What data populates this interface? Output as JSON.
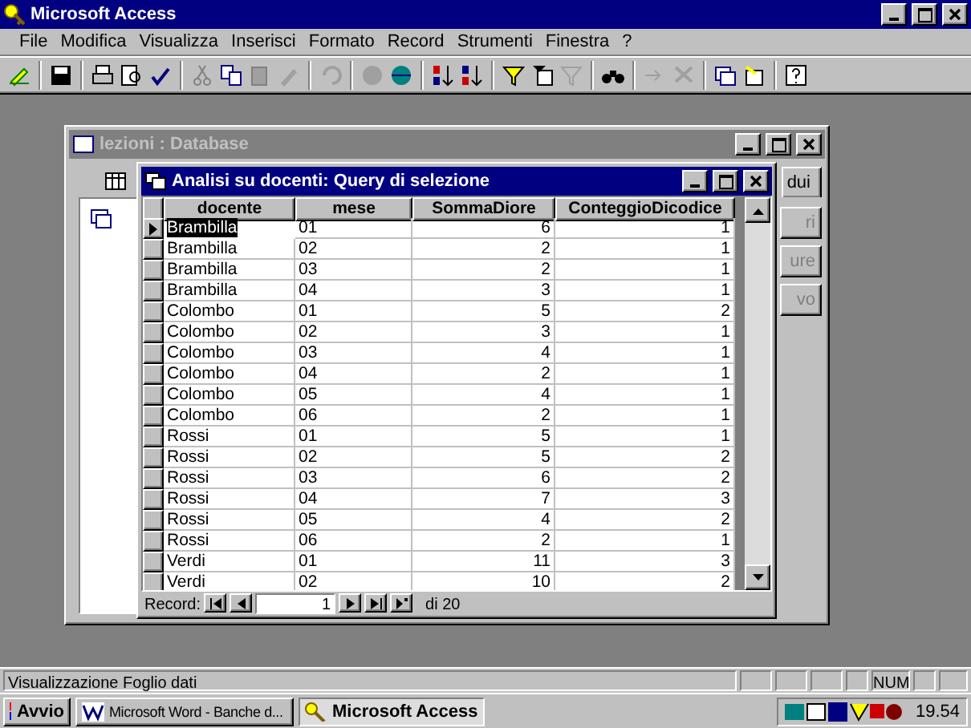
{
  "window": {
    "title": "Microsoft Access"
  },
  "menu": [
    "File",
    "Modifica",
    "Visualizza",
    "Inserisci",
    "Formato",
    "Record",
    "Strumenti",
    "Finestra",
    "?"
  ],
  "database_window": {
    "title": "lezioni : Database",
    "tab_fragment": "dui",
    "buttons": [
      "ri",
      "ure",
      "vo"
    ]
  },
  "query_window": {
    "title": "Analisi su docenti: Query di selezione",
    "columns": [
      "docente",
      "mese",
      "SommaDiore",
      "ConteggioDicodice"
    ],
    "rows": [
      {
        "cells": [
          "Brambilla",
          "01",
          "6",
          "1"
        ],
        "selected": true
      },
      {
        "cells": [
          "Brambilla",
          "02",
          "2",
          "1"
        ],
        "selected": false
      },
      {
        "cells": [
          "Brambilla",
          "03",
          "2",
          "1"
        ],
        "selected": false
      },
      {
        "cells": [
          "Brambilla",
          "04",
          "3",
          "1"
        ],
        "selected": false
      },
      {
        "cells": [
          "Colombo",
          "01",
          "5",
          "2"
        ],
        "selected": false
      },
      {
        "cells": [
          "Colombo",
          "02",
          "3",
          "1"
        ],
        "selected": false
      },
      {
        "cells": [
          "Colombo",
          "03",
          "4",
          "1"
        ],
        "selected": false
      },
      {
        "cells": [
          "Colombo",
          "04",
          "2",
          "1"
        ],
        "selected": false
      },
      {
        "cells": [
          "Colombo",
          "05",
          "4",
          "1"
        ],
        "selected": false
      },
      {
        "cells": [
          "Colombo",
          "06",
          "2",
          "1"
        ],
        "selected": false
      },
      {
        "cells": [
          "Rossi",
          "01",
          "5",
          "1"
        ],
        "selected": false
      },
      {
        "cells": [
          "Rossi",
          "02",
          "5",
          "2"
        ],
        "selected": false
      },
      {
        "cells": [
          "Rossi",
          "03",
          "6",
          "2"
        ],
        "selected": false
      },
      {
        "cells": [
          "Rossi",
          "04",
          "7",
          "3"
        ],
        "selected": false
      },
      {
        "cells": [
          "Rossi",
          "05",
          "4",
          "2"
        ],
        "selected": false
      },
      {
        "cells": [
          "Rossi",
          "06",
          "2",
          "1"
        ],
        "selected": false
      },
      {
        "cells": [
          "Verdi",
          "01",
          "11",
          "3"
        ],
        "selected": false
      },
      {
        "cells": [
          "Verdi",
          "02",
          "10",
          "2"
        ],
        "selected": false
      }
    ],
    "navigator": {
      "label": "Record:",
      "current": "1",
      "total": "di 20"
    }
  },
  "status_bar": {
    "text": "Visualizzazione Foglio dati",
    "indicator": "NUM"
  },
  "taskbar": {
    "start": "Avvio",
    "buttons": [
      {
        "label": "Microsoft Word - Banche d...",
        "selected": false
      },
      {
        "label": "Microsoft Access",
        "selected": true
      }
    ],
    "clock": "19.54"
  }
}
